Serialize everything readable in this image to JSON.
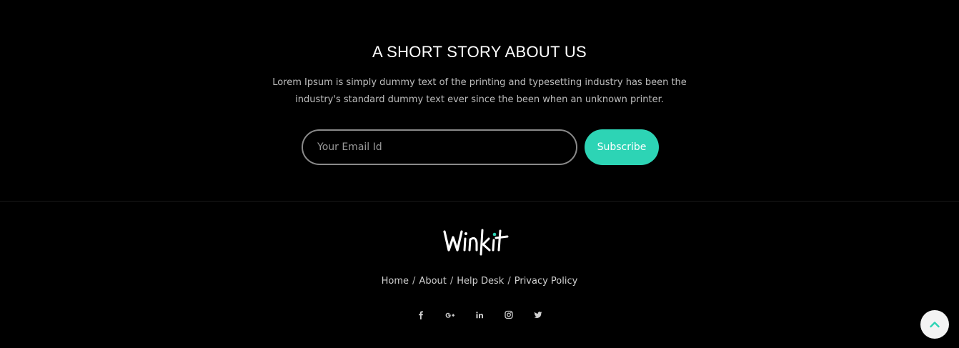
{
  "newsletter": {
    "heading": "A SHORT STORY ABOUT US",
    "description": "Lorem Ipsum is simply dummy text of the printing and typesetting industry has been the industry's standard dummy text ever since the been when an unknown printer.",
    "email_placeholder": "Your Email Id",
    "email_value": "",
    "subscribe_label": "Subscribe"
  },
  "footer": {
    "logo_text": "Winkit",
    "nav": [
      {
        "label": "Home"
      },
      {
        "label": "About"
      },
      {
        "label": "Help Desk"
      },
      {
        "label": "Privacy Policy"
      }
    ],
    "separator": "/",
    "social_icons": [
      "facebook-icon",
      "google-plus-icon",
      "linkedin-icon",
      "instagram-icon",
      "twitter-icon"
    ]
  },
  "colors": {
    "background": "#000000",
    "accent": "#2dd4b5",
    "text_muted": "#bdbdbd",
    "input_border": "#8a8a8a",
    "to_top_bg": "#f3f3f3"
  }
}
